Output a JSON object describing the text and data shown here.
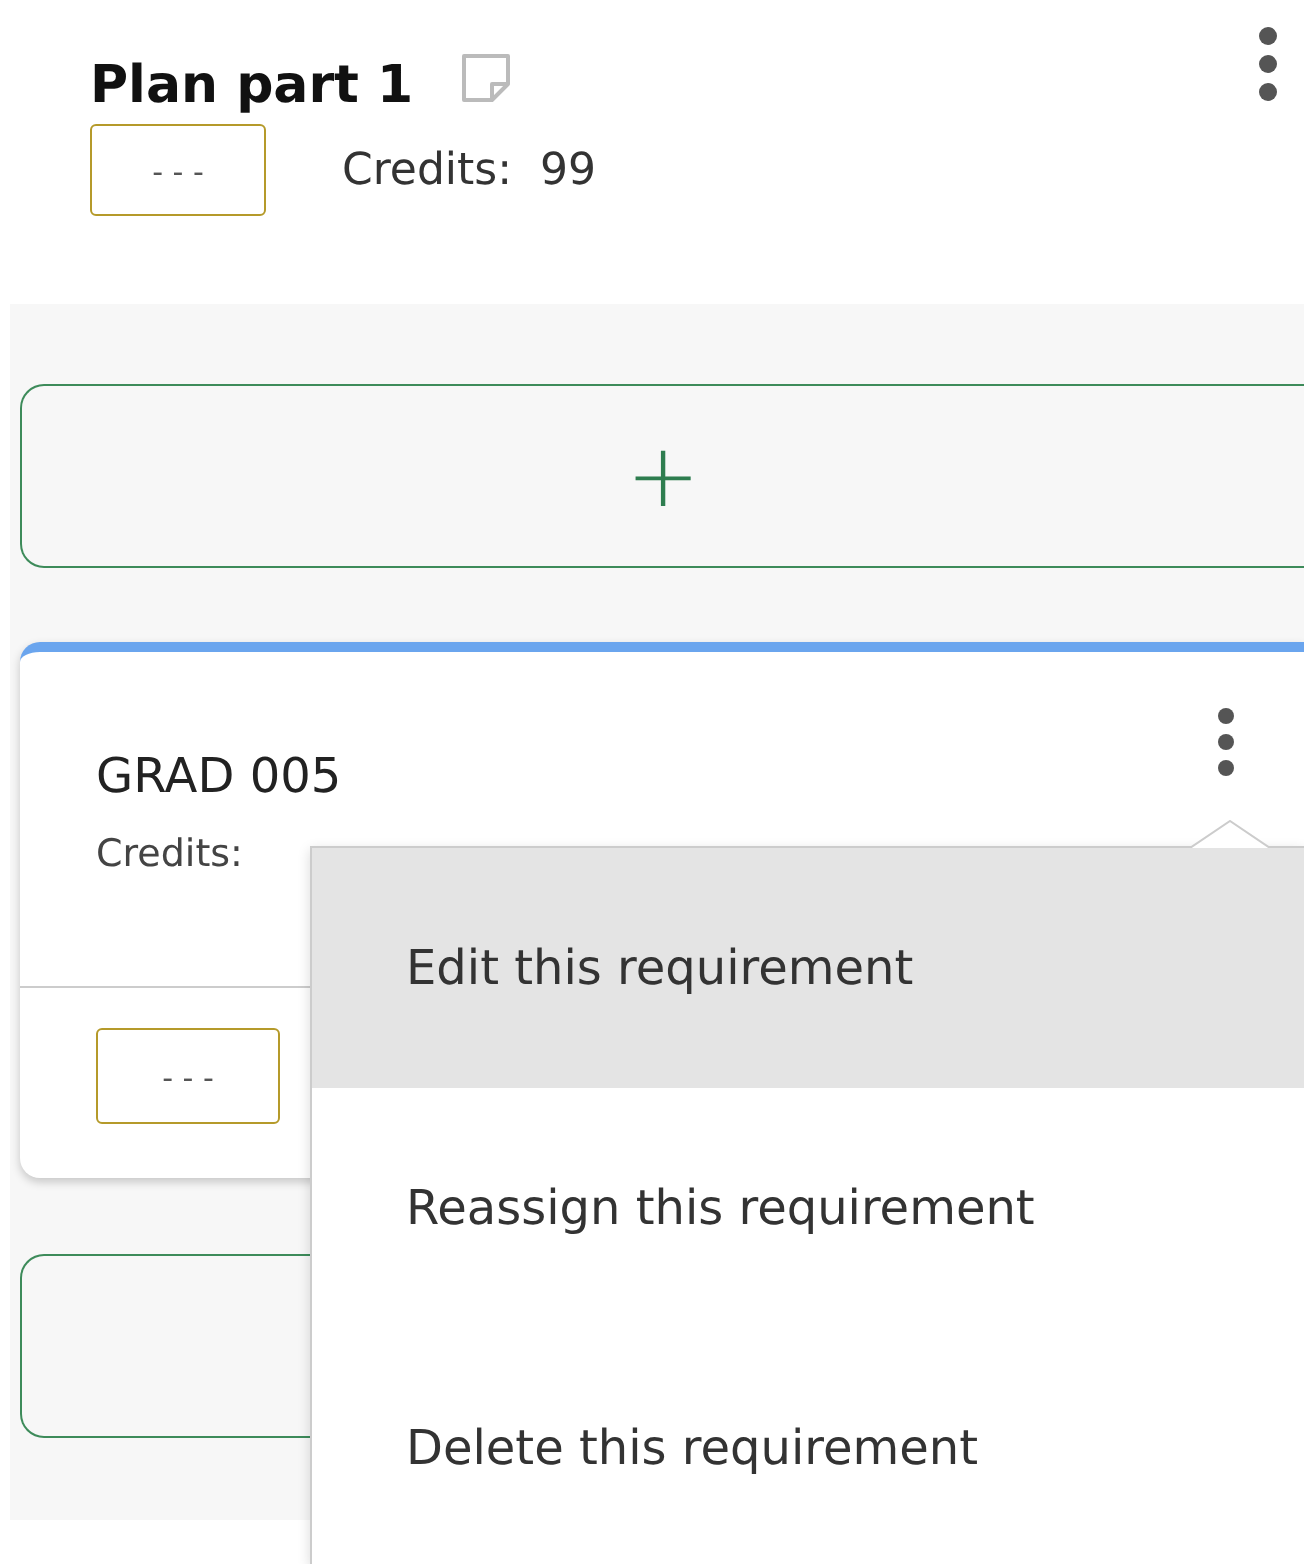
{
  "plan": {
    "title": "Plan part 1",
    "grade": "- - -",
    "credits_label": "Credits:",
    "credits": "99"
  },
  "add_button": {
    "label": "+"
  },
  "requirement": {
    "code": "GRAD 005",
    "credits_label": "Credits:",
    "grade": "- - -"
  },
  "menu": {
    "items": [
      {
        "label": "Edit this requirement",
        "selected": true
      },
      {
        "label": "Reassign this requirement",
        "selected": false
      },
      {
        "label": "Delete this requirement",
        "selected": false
      }
    ]
  }
}
